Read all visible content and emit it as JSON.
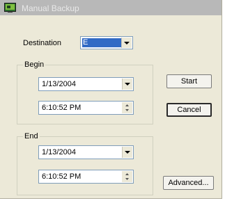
{
  "window": {
    "title": "Manual Backup",
    "icon": "app-icon"
  },
  "destination": {
    "label": "Destination",
    "value": "E"
  },
  "begin": {
    "group_label": "Begin",
    "date": "1/13/2004",
    "time": "6:10:52 PM"
  },
  "end": {
    "group_label": "End",
    "date": "1/13/2004",
    "time": "6:10:52 PM"
  },
  "buttons": {
    "start": "Start",
    "cancel": "Cancel",
    "advanced": "Advanced..."
  },
  "colors": {
    "dialog_background": "#ece9d8",
    "selection": "#316ac5",
    "titlebar_inactive": "#b8b8b8"
  }
}
